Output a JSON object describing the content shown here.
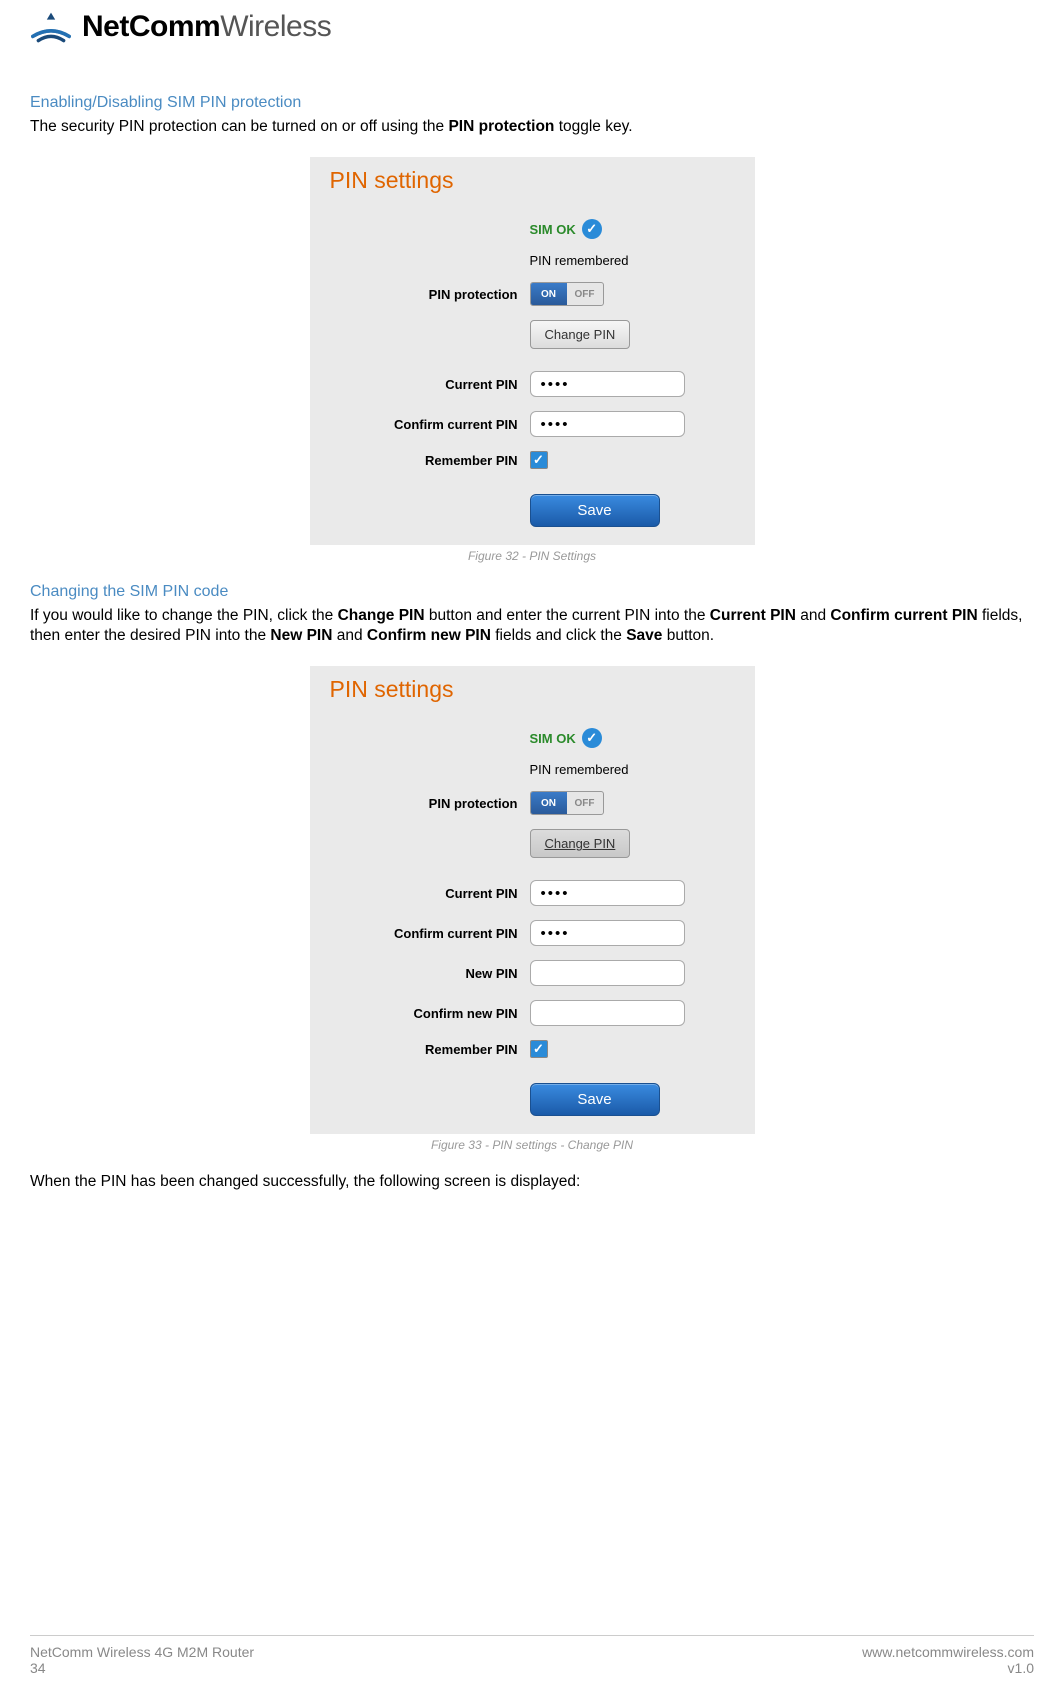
{
  "brand": {
    "bold": "NetComm",
    "light": "Wireless"
  },
  "section1": {
    "title": "Enabling/Disabling SIM PIN protection",
    "text_before": "The security PIN protection can be turned on or off using the ",
    "text_bold": "PIN protection",
    "text_after": " toggle key."
  },
  "panel1": {
    "title": "PIN settings",
    "sim_ok": "SIM OK",
    "pin_remembered": "PIN remembered",
    "pin_protection_label": "PIN protection",
    "toggle_on": "ON",
    "toggle_off": "OFF",
    "change_pin_btn": "Change PIN",
    "current_pin_label": "Current PIN",
    "current_pin_value": "••••",
    "confirm_current_label": "Confirm current PIN",
    "confirm_current_value": "••••",
    "remember_pin_label": "Remember PIN",
    "save_btn": "Save"
  },
  "caption1": "Figure 32 - PIN Settings",
  "section2": {
    "title": "Changing the SIM PIN code",
    "t1": "If you would like to change the PIN, click the ",
    "b1": "Change PIN",
    "t2": " button and enter the current PIN into the ",
    "b2": "Current PIN",
    "t3": " and ",
    "b3": "Confirm current PIN",
    "t4": " fields, then enter the desired PIN into the ",
    "b4": "New PIN",
    "t5": " and ",
    "b5": "Confirm new PIN",
    "t6": " fields and click the ",
    "b6": "Save",
    "t7": " button."
  },
  "panel2": {
    "title": "PIN settings",
    "sim_ok": "SIM OK",
    "pin_remembered": "PIN remembered",
    "pin_protection_label": "PIN protection",
    "toggle_on": "ON",
    "toggle_off": "OFF",
    "change_pin_btn": "Change PIN",
    "current_pin_label": "Current PIN",
    "current_pin_value": "••••",
    "confirm_current_label": "Confirm current PIN",
    "confirm_current_value": "••••",
    "new_pin_label": "New PIN",
    "confirm_new_label": "Confirm new PIN",
    "remember_pin_label": "Remember PIN",
    "save_btn": "Save"
  },
  "caption2": "Figure 33 - PIN settings - Change PIN",
  "closing_text": "When the PIN has been changed successfully, the following screen is displayed:",
  "footer": {
    "left1": "NetComm Wireless 4G M2M Router",
    "left2": "34",
    "right1": "www.netcommwireless.com",
    "right2": "v1.0"
  }
}
